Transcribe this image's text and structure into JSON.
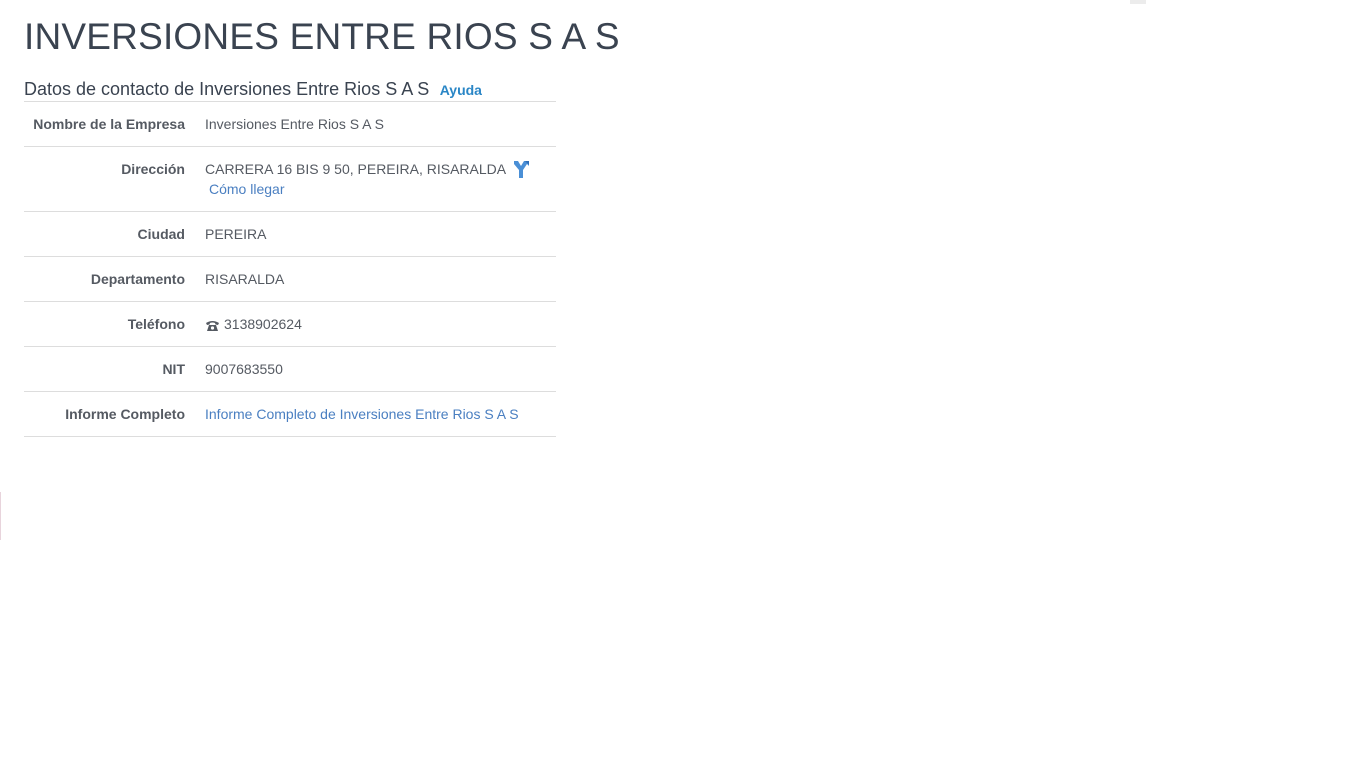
{
  "company": {
    "title": "INVERSIONES ENTRE RIOS S A S"
  },
  "contact_section": {
    "heading": "Datos de contacto de Inversiones Entre Rios S A S",
    "help_label": "Ayuda"
  },
  "fields": {
    "name": {
      "label": "Nombre de la Empresa",
      "value": "Inversiones Entre Rios S A S"
    },
    "address": {
      "label": "Dirección",
      "value": "CARRERA 16 BIS 9 50, PEREIRA, RISARALDA",
      "directions_label": "Cómo llegar",
      "icon": "directions-icon"
    },
    "city": {
      "label": "Ciudad",
      "value": "PEREIRA"
    },
    "department": {
      "label": "Departamento",
      "value": "RISARALDA"
    },
    "phone": {
      "label": "Teléfono",
      "value": "3138902624",
      "icon": "phone-icon"
    },
    "nit": {
      "label": "NIT",
      "value": "9007683550"
    },
    "report": {
      "label": "Informe Completo",
      "link_text": "Informe Completo de Inversiones Entre Rios S A S"
    }
  },
  "colors": {
    "title": "#3a4350",
    "text": "#555a62",
    "link": "#4a7fc1",
    "help_link": "#2a86c6",
    "divider": "#dddddd"
  }
}
